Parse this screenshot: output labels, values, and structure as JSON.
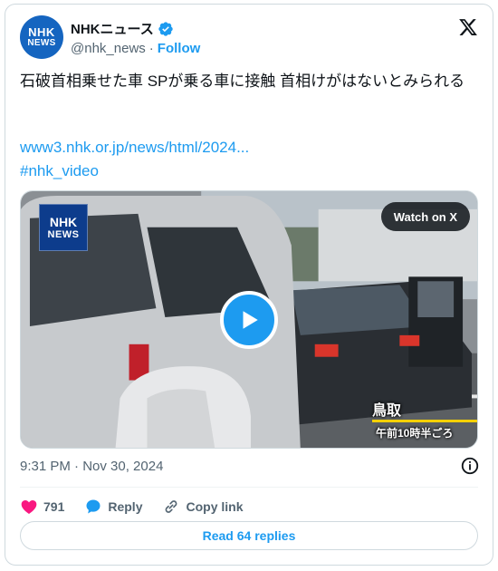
{
  "author": {
    "avatar_text_top": "NHK",
    "avatar_text_bottom": "NEWS",
    "display_name": "NHKニュース",
    "handle": "@nhk_news",
    "separator": "·",
    "follow_label": "Follow",
    "verified_color": "#1d9bf0"
  },
  "tweet": {
    "text": "石破首相乗せた車 SPが乗る車に接触 首相けがはないとみられる",
    "link": "www3.nhk.or.jp/news/html/2024...",
    "hashtag": "#nhk_video"
  },
  "media": {
    "logo_top": "NHK",
    "logo_bottom": "NEWS",
    "watch_label": "Watch on X",
    "caption_place": "鳥取",
    "caption_time": "午前10時半ごろ",
    "play_icon": "play-icon"
  },
  "meta": {
    "timestamp": "9:31 PM · Nov 30, 2024"
  },
  "actions": {
    "like_count": "791",
    "reply_label": "Reply",
    "copy_label": "Copy link",
    "read_replies": "Read 64 replies"
  },
  "colors": {
    "accent": "#1d9bf0",
    "like": "#f91880",
    "text": "#0f1419",
    "muted": "#536471"
  }
}
